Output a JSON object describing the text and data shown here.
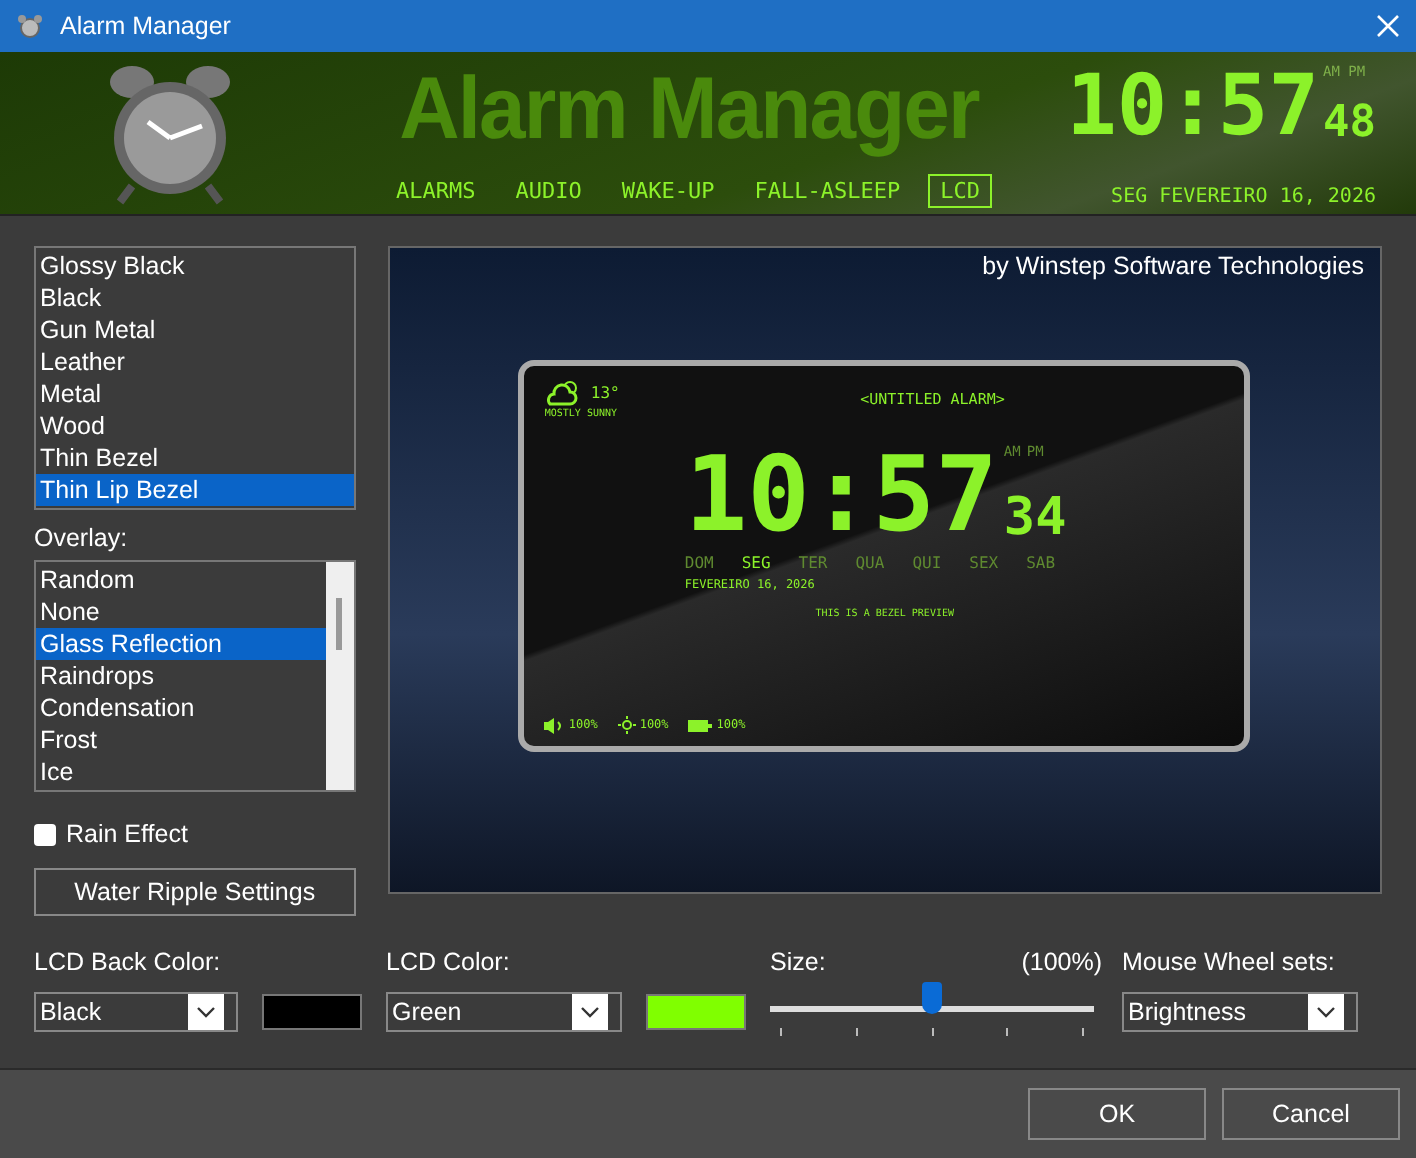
{
  "window": {
    "title": "Alarm Manager"
  },
  "banner": {
    "title": "Alarm Manager",
    "clock": {
      "time": "10:57",
      "seconds": "48",
      "am": "AM",
      "pm": "PM"
    },
    "date": "SEG FEVEREIRO 16, 2026",
    "tabs": [
      {
        "label": "ALARMS",
        "selected": false
      },
      {
        "label": "AUDIO",
        "selected": false
      },
      {
        "label": "WAKE-UP",
        "selected": false
      },
      {
        "label": "FALL-ASLEEP",
        "selected": false
      },
      {
        "label": "LCD",
        "selected": true
      }
    ]
  },
  "bezels": [
    {
      "label": "Glossy Black",
      "selected": false
    },
    {
      "label": "Black",
      "selected": false
    },
    {
      "label": "Gun Metal",
      "selected": false
    },
    {
      "label": "Leather",
      "selected": false
    },
    {
      "label": "Metal",
      "selected": false
    },
    {
      "label": "Wood",
      "selected": false
    },
    {
      "label": "Thin Bezel",
      "selected": false
    },
    {
      "label": "Thin Lip Bezel",
      "selected": true
    }
  ],
  "overlay": {
    "label": "Overlay:",
    "items": [
      {
        "label": "Random",
        "selected": false
      },
      {
        "label": "None",
        "selected": false
      },
      {
        "label": "Glass Reflection",
        "selected": true
      },
      {
        "label": "Raindrops",
        "selected": false
      },
      {
        "label": "Condensation",
        "selected": false
      },
      {
        "label": "Frost",
        "selected": false
      },
      {
        "label": "Ice",
        "selected": false
      }
    ]
  },
  "rain_effect": {
    "label": "Rain Effect",
    "checked": false
  },
  "water_ripple_button": "Water Ripple Settings",
  "preview": {
    "credit": "by Winstep Software Technologies",
    "weather_temp": "13°",
    "weather_text": "MOSTLY SUNNY",
    "alarm_name": "<UNTITLED ALARM>",
    "am": "AM",
    "pm": "PM",
    "time": "10:57",
    "seconds": "34",
    "days": [
      {
        "label": "DOM",
        "selected": false
      },
      {
        "label": "SEG",
        "selected": true
      },
      {
        "label": "TER",
        "selected": false
      },
      {
        "label": "QUA",
        "selected": false
      },
      {
        "label": "QUI",
        "selected": false
      },
      {
        "label": "SEX",
        "selected": false
      },
      {
        "label": "SAB",
        "selected": false
      }
    ],
    "date": "FEVEREIRO 16, 2026",
    "message": "THIS IS A BEZEL PREVIEW",
    "volume": "100%",
    "brightness": "100%",
    "battery": "100%"
  },
  "lcd_back_color": {
    "label": "LCD Back Color:",
    "value": "Black",
    "color": "#000000"
  },
  "lcd_color": {
    "label": "LCD Color:",
    "value": "Green",
    "color": "#80ff00"
  },
  "size": {
    "label": "Size:",
    "reading": "(100%)",
    "level": 0.5
  },
  "mouse_wheel": {
    "label": "Mouse Wheel sets:",
    "value": "Brightness"
  },
  "buttons": [
    "OK",
    "Cancel"
  ]
}
